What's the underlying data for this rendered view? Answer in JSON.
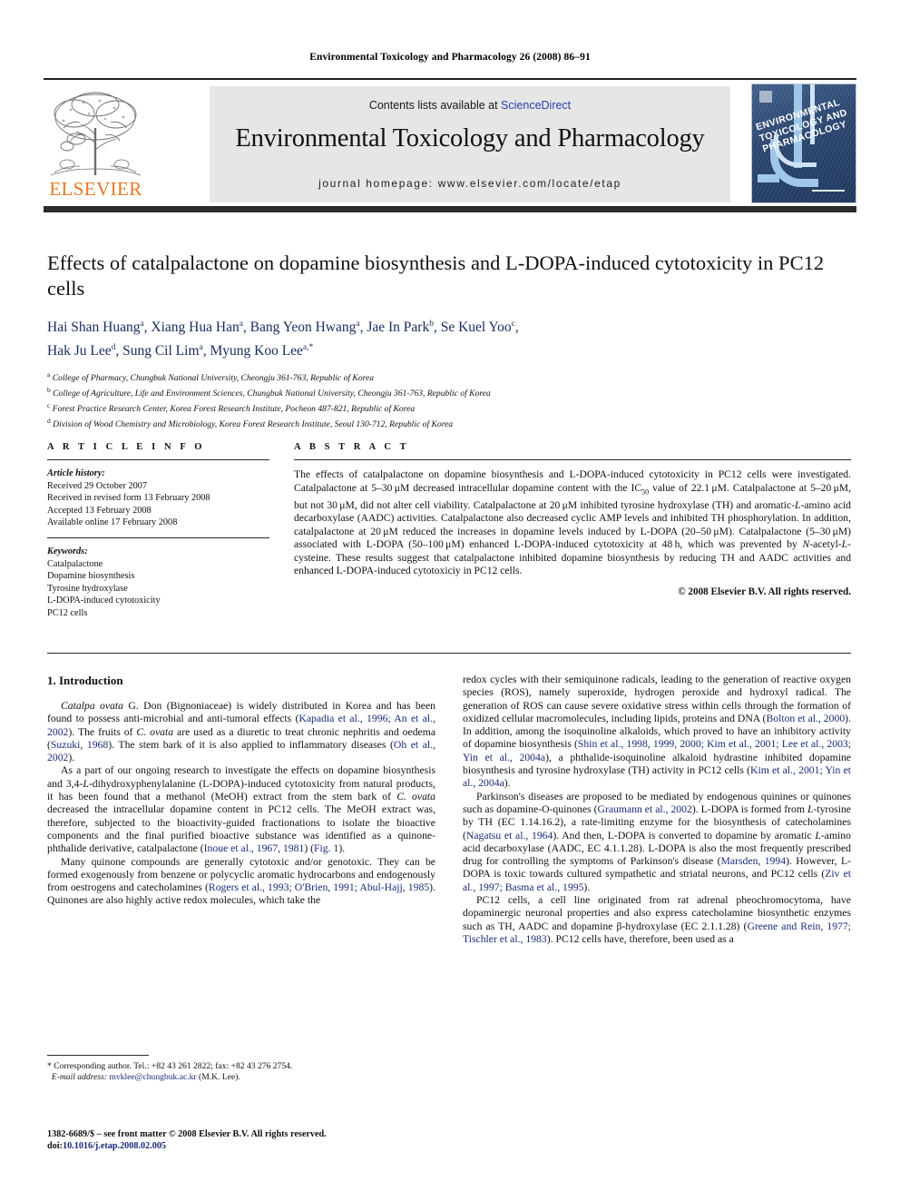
{
  "running_head": "Environmental Toxicology and Pharmacology 26 (2008) 86–91",
  "masthead": {
    "contents_prefix": "Contents lists available at ",
    "sciencedirect": "ScienceDirect",
    "journal_title": "Environmental Toxicology and Pharmacology",
    "homepage": "journal homepage: www.elsevier.com/locate/etap",
    "publisher_wordmark": "ELSEVIER",
    "cover_title": "ENVIRONMENTAL TOXICOLOGY AND PHARMACOLOGY",
    "link_color": "#2b43a8",
    "wordmark_color": "#e87722"
  },
  "article": {
    "title": "Effects of catalpalactone on dopamine biosynthesis and L-DOPA-induced cytotoxicity in PC12 cells",
    "authors_line1": "Hai Shan Huang a, Xiang Hua Han a, Bang Yeon Hwang a, Jae In Park b, Se Kuel Yoo c,",
    "authors_line2": "Hak Ju Lee d, Sung Cil Lim a, Myung Koo Lee a,*",
    "affiliations": [
      {
        "mark": "a",
        "text": "College of Pharmacy, Chungbuk National University, Cheongju 361-763, Republic of Korea"
      },
      {
        "mark": "b",
        "text": "College of Agriculture, Life and Environment Sciences, Chungbuk National University, Cheongju 361-763, Republic of Korea"
      },
      {
        "mark": "c",
        "text": "Forest Practice Research Center, Korea Forest Research Institute, Pocheon 487-821, Republic of Korea"
      },
      {
        "mark": "d",
        "text": "Division of Wood Chemistry and Microbiology, Korea Forest Research Institute, Seoul 130-712, Republic of Korea"
      }
    ]
  },
  "article_info": {
    "heading": "A R T I C L E   I N F O",
    "history_label": "Article history:",
    "history": [
      "Received 29 October 2007",
      "Received in revised form 13 February 2008",
      "Accepted 13 February 2008",
      "Available online 17 February 2008"
    ],
    "keywords_label": "Keywords:",
    "keywords": [
      "Catalpalactone",
      "Dopamine biosynthesis",
      "Tyrosine hydroxylase",
      "L-DOPA-induced cytotoxicity",
      "PC12 cells"
    ]
  },
  "abstract": {
    "heading": "A B S T R A C T",
    "copyright": "© 2008 Elsevier B.V. All rights reserved."
  },
  "body": {
    "section1_heading": "1. Introduction",
    "footnote_corresponding": "* Corresponding author. Tel.: +82 43 261 2822; fax: +82 43 276 2754.",
    "footnote_email_label": "E-mail address:",
    "footnote_email": "mvklee@chungbuk.ac.kr",
    "footnote_email_suffix": " (M.K. Lee).",
    "imprint_line": "1382-6689/$ – see front matter © 2008 Elsevier B.V. All rights reserved.",
    "doi_label": "doi:",
    "doi": "10.1016/j.etap.2008.02.005"
  }
}
